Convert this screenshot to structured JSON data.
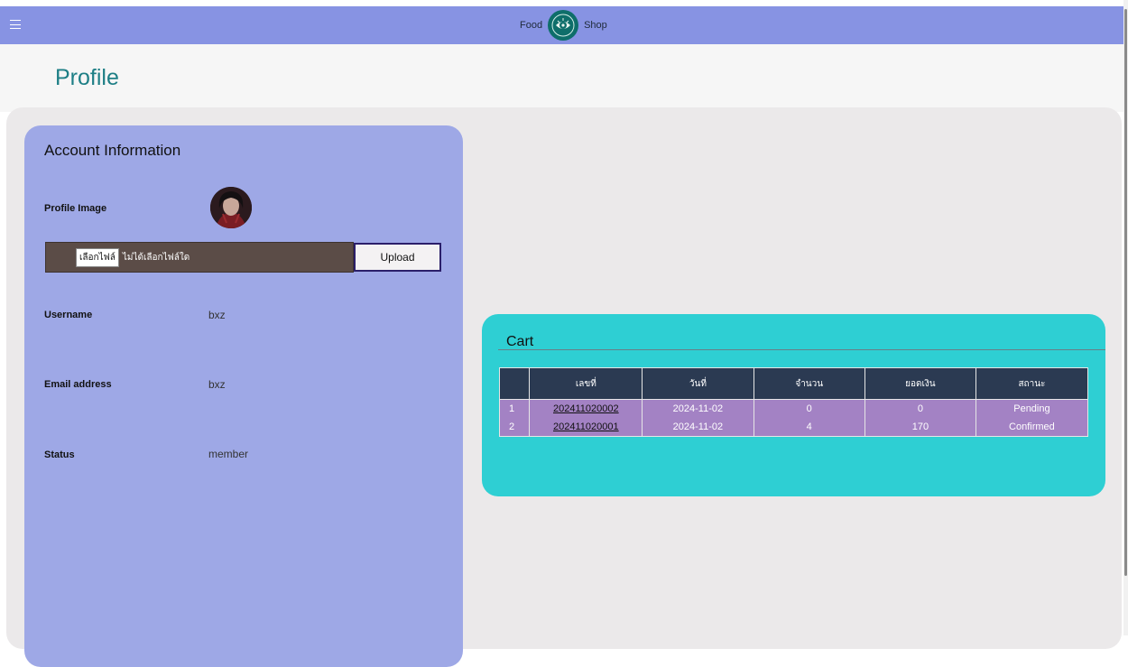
{
  "header": {
    "brand_left": "Food",
    "brand_right": "Shop",
    "logo_icon": "eye-logo-icon",
    "menu_icon": "hamburger-menu-icon",
    "bar_color": "#8793e3"
  },
  "page": {
    "title": "Profile"
  },
  "account": {
    "title": "Account Information",
    "profile_image_label": "Profile Image",
    "file_button_label": "เลือกไฟล์",
    "file_status": "ไม่ได้เลือกไฟล์ใด",
    "upload_label": "Upload",
    "username_label": "Username",
    "username_value": "bxz",
    "email_label": "Email address",
    "email_value": "bxz",
    "status_label": "Status",
    "status_value": "member",
    "card_color": "#9ea8e6"
  },
  "cart": {
    "title": "Cart",
    "columns": [
      "",
      "เลขที่",
      "วันที่",
      "จำนวน",
      "ยอดเงิน",
      "สถานะ"
    ],
    "rows": [
      {
        "index": "1",
        "order_no": "202411020002",
        "date": "2024-11-02",
        "qty": "0",
        "amount": "0",
        "status": "Pending"
      },
      {
        "index": "2",
        "order_no": "202411020001",
        "date": "2024-11-02",
        "qty": "4",
        "amount": "170",
        "status": "Confirmed"
      }
    ],
    "card_color": "#2ecfd3",
    "header_color": "#2b3a52",
    "row_color": "#a382c4"
  }
}
